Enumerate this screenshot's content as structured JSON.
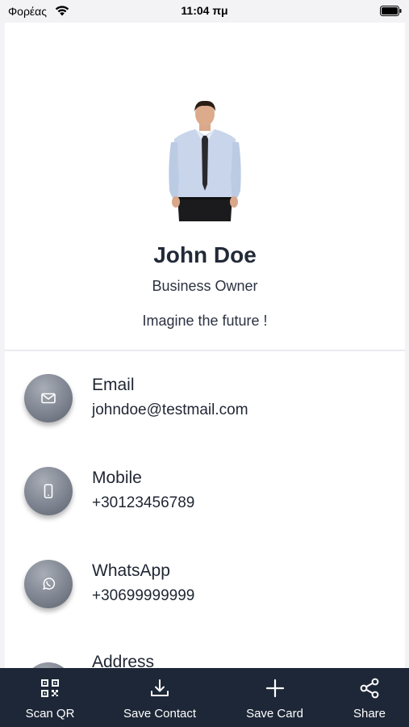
{
  "status_bar": {
    "carrier": "Φορέας",
    "time": "11:04 πμ"
  },
  "profile": {
    "name": "John Doe",
    "role": "Business Owner",
    "motto": "Imagine the future !"
  },
  "contacts": [
    {
      "icon": "mail-icon",
      "label": "Email",
      "value": "johndoe@testmail.com"
    },
    {
      "icon": "phone-icon",
      "label": "Mobile",
      "value": "+30123456789"
    },
    {
      "icon": "whatsapp-icon",
      "label": "WhatsApp",
      "value": "+30699999999"
    },
    {
      "icon": "location-icon",
      "label": "Address",
      "value": ""
    }
  ],
  "tabbar": {
    "items": [
      {
        "icon": "qr-code-icon",
        "label": "Scan QR"
      },
      {
        "icon": "download-icon",
        "label": "Save Contact"
      },
      {
        "icon": "plus-icon",
        "label": "Save Card"
      },
      {
        "icon": "share-icon",
        "label": "Share"
      }
    ]
  },
  "colors": {
    "tabbar_background": "#1d2737",
    "page_background": "#f3f3f6",
    "icon_circle": "#7e8490"
  }
}
